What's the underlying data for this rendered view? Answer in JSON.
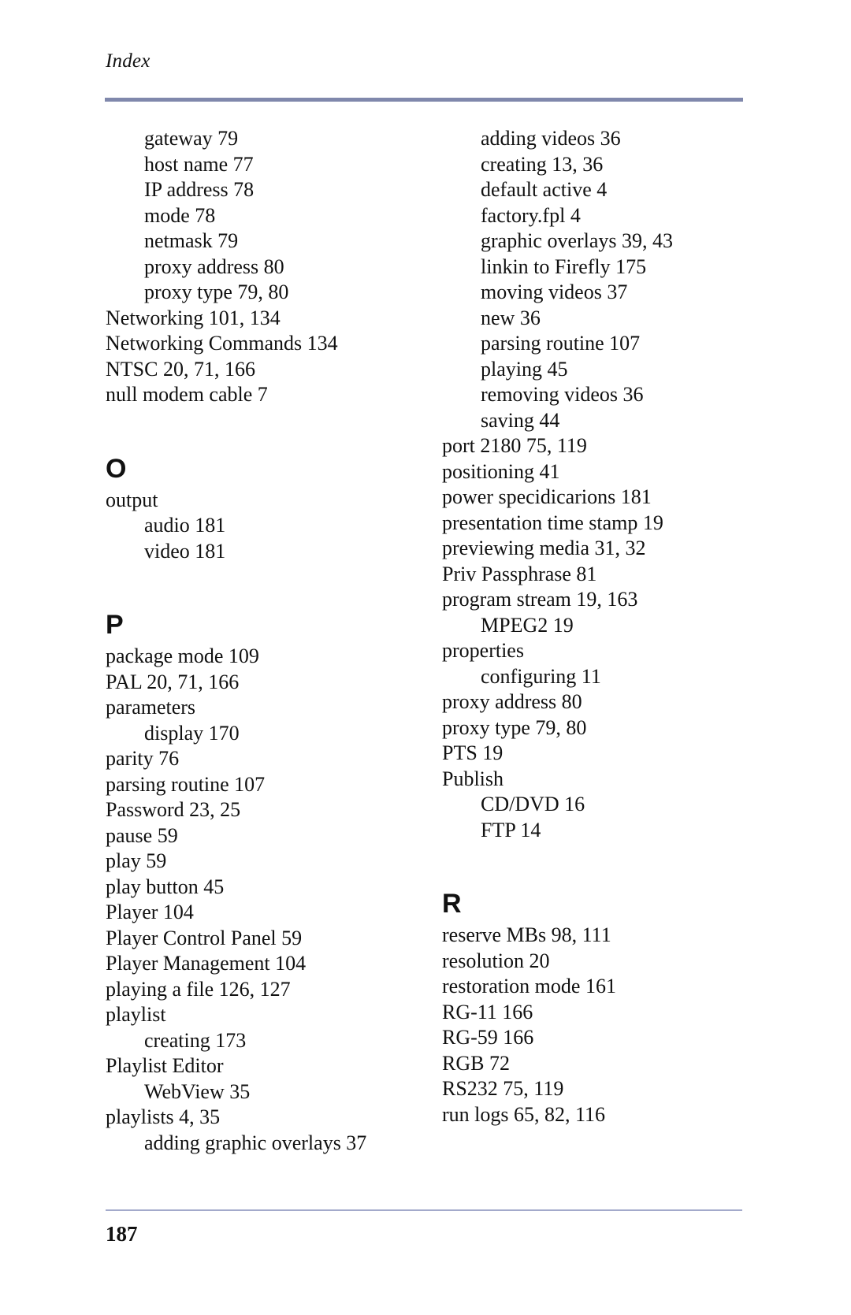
{
  "header": {
    "running_head": "Index"
  },
  "footer": {
    "page_number": "187"
  },
  "colors": {
    "rule": "#8088ac",
    "text": "#111111"
  },
  "columns": [
    {
      "blocks": [
        {
          "type": "entries",
          "entries": [
            {
              "level": 2,
              "text": "gateway 79"
            },
            {
              "level": 2,
              "text": "host name 77"
            },
            {
              "level": 2,
              "text": "IP address 78"
            },
            {
              "level": 2,
              "text": "mode 78"
            },
            {
              "level": 2,
              "text": "netmask 79"
            },
            {
              "level": 2,
              "text": "proxy address 80"
            },
            {
              "level": 2,
              "text": "proxy type 79, 80"
            },
            {
              "level": 1,
              "text": "Networking 101, 134"
            },
            {
              "level": 1,
              "text": "Networking Commands 134"
            },
            {
              "level": 1,
              "text": "NTSC 20, 71, 166"
            },
            {
              "level": 1,
              "text": "null modem cable 7"
            }
          ]
        },
        {
          "type": "letter",
          "text": "O"
        },
        {
          "type": "entries",
          "entries": [
            {
              "level": 1,
              "text": "output"
            },
            {
              "level": 2,
              "text": "audio 181"
            },
            {
              "level": 2,
              "text": "video 181"
            }
          ]
        },
        {
          "type": "letter",
          "text": "P"
        },
        {
          "type": "entries",
          "entries": [
            {
              "level": 1,
              "text": "package mode 109"
            },
            {
              "level": 1,
              "text": "PAL 20, 71, 166"
            },
            {
              "level": 1,
              "text": "parameters"
            },
            {
              "level": 2,
              "text": "display 170"
            },
            {
              "level": 1,
              "text": "parity 76"
            },
            {
              "level": 1,
              "text": "parsing routine 107"
            },
            {
              "level": 1,
              "text": "Password 23, 25"
            },
            {
              "level": 1,
              "text": "pause 59"
            },
            {
              "level": 1,
              "text": "play 59"
            },
            {
              "level": 1,
              "text": "play button 45"
            },
            {
              "level": 1,
              "text": "Player 104"
            },
            {
              "level": 1,
              "text": "Player Control Panel 59"
            },
            {
              "level": 1,
              "text": "Player Management 104"
            },
            {
              "level": 1,
              "text": "playing a file 126, 127"
            },
            {
              "level": 1,
              "text": "playlist"
            },
            {
              "level": 2,
              "text": "creating 173"
            },
            {
              "level": 1,
              "text": "Playlist Editor"
            },
            {
              "level": 2,
              "text": "WebView 35"
            },
            {
              "level": 1,
              "text": "playlists 4, 35"
            },
            {
              "level": 2,
              "text": "adding graphic overlays 37"
            }
          ]
        }
      ]
    },
    {
      "blocks": [
        {
          "type": "entries",
          "entries": [
            {
              "level": 2,
              "text": "adding videos 36"
            },
            {
              "level": 2,
              "text": "creating 13, 36"
            },
            {
              "level": 2,
              "text": "default active 4"
            },
            {
              "level": 2,
              "text": "factory.fpl 4"
            },
            {
              "level": 2,
              "text": "graphic overlays 39, 43"
            },
            {
              "level": 2,
              "text": "linkin to Firefly 175"
            },
            {
              "level": 2,
              "text": "moving videos 37"
            },
            {
              "level": 2,
              "text": "new 36"
            },
            {
              "level": 2,
              "text": "parsing routine 107"
            },
            {
              "level": 2,
              "text": "playing 45"
            },
            {
              "level": 2,
              "text": "removing videos 36"
            },
            {
              "level": 2,
              "text": "saving 44"
            },
            {
              "level": 1,
              "text": "port 2180 75, 119"
            },
            {
              "level": 1,
              "text": "positioning 41"
            },
            {
              "level": 1,
              "text": "power specidicarions 181"
            },
            {
              "level": 1,
              "text": "presentation time stamp 19"
            },
            {
              "level": 1,
              "text": "previewing media 31, 32"
            },
            {
              "level": 1,
              "text": "Priv Passphrase 81"
            },
            {
              "level": 1,
              "text": "program stream 19, 163"
            },
            {
              "level": 2,
              "text": "MPEG2 19"
            },
            {
              "level": 1,
              "text": "properties"
            },
            {
              "level": 2,
              "text": "configuring 11"
            },
            {
              "level": 1,
              "text": "proxy address 80"
            },
            {
              "level": 1,
              "text": "proxy type 79, 80"
            },
            {
              "level": 1,
              "text": "PTS 19"
            },
            {
              "level": 1,
              "text": "Publish"
            },
            {
              "level": 2,
              "text": "CD/DVD 16"
            },
            {
              "level": 2,
              "text": "FTP 14"
            }
          ]
        },
        {
          "type": "letter",
          "text": "R"
        },
        {
          "type": "entries",
          "entries": [
            {
              "level": 1,
              "text": "reserve MBs 98, 111"
            },
            {
              "level": 1,
              "text": "resolution 20"
            },
            {
              "level": 1,
              "text": "restoration mode 161"
            },
            {
              "level": 1,
              "text": "RG-11 166"
            },
            {
              "level": 1,
              "text": "RG-59 166"
            },
            {
              "level": 1,
              "text": "RGB 72"
            },
            {
              "level": 1,
              "text": "RS232 75, 119"
            },
            {
              "level": 1,
              "text": "run logs 65, 82, 116"
            }
          ]
        }
      ]
    }
  ]
}
